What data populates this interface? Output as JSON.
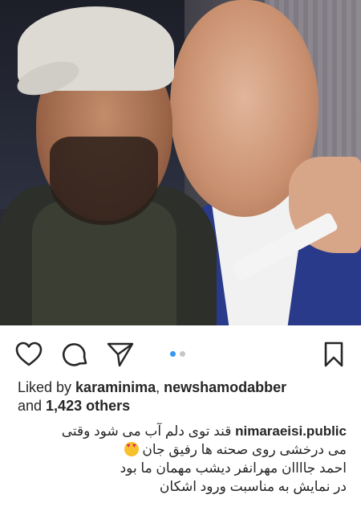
{
  "post": {
    "photo_alt": "Selfie of two men",
    "carousel": {
      "count": 2,
      "active_index": 0
    }
  },
  "likes": {
    "prefix": "Liked by ",
    "users": [
      "karaminima",
      "newshamodabber"
    ],
    "separator": ", ",
    "and_text": "and ",
    "others": "1,423 others"
  },
  "caption": {
    "username": "nimaraeisi.public",
    "line1": "قند توی دلم آب می شود وقتی",
    "line2": "می درخشی روی صحنه ها رفیق جان",
    "line3": "احمد جاااان مهرانفر دیشب مهمان ما بود",
    "line4": "در نمایش به مناسبت ورود اشکان"
  },
  "icons": [
    "heart-icon",
    "comment-icon",
    "share-icon",
    "bookmark-icon"
  ],
  "colors": {
    "text": "#262626",
    "accent": "#3897f0",
    "inactive_dot": "#c7c7c7"
  }
}
